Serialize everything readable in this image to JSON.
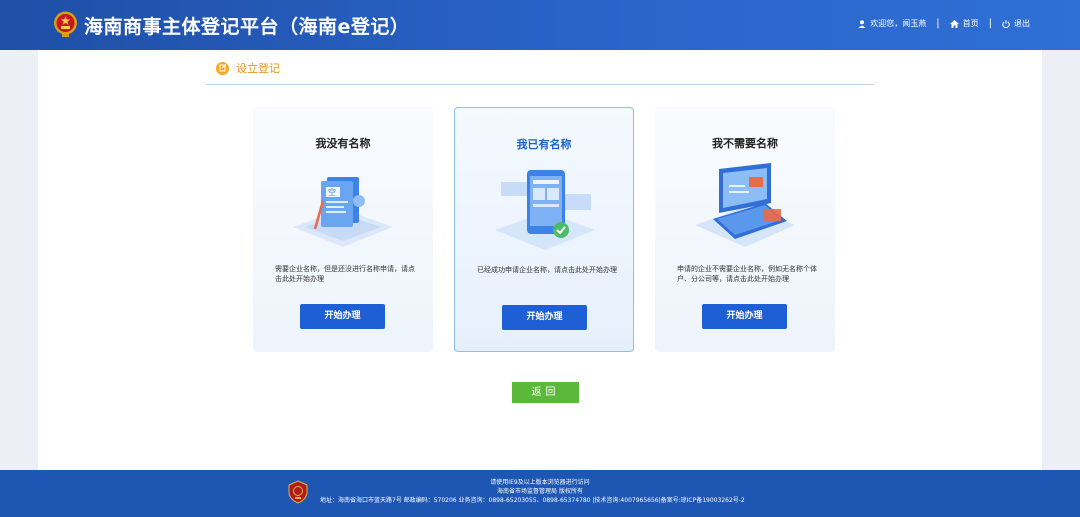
{
  "header": {
    "site_title": "海南商事主体登记平台（海南e登记）",
    "welcome": "欢迎您，闻玉燕",
    "home": "首页",
    "logout": "退出",
    "separator": "|"
  },
  "section": {
    "title": "设立登记"
  },
  "cards": [
    {
      "title": "我没有名称",
      "desc": "需要企业名称，但是还没进行名称申请，请点击此处开始办理",
      "button": "开始办理"
    },
    {
      "title": "我已有名称",
      "desc": "已经成功申请企业名称，请点击此处开始办理",
      "button": "开始办理"
    },
    {
      "title": "我不需要名称",
      "desc": "申请的企业不需要企业名称，例如无名称个体户、分公司等，请点击此处开始办理",
      "button": "开始办理"
    }
  ],
  "back_button": "返回",
  "footer": {
    "line1": "请使用IE9及以上版本浏览器进行访问",
    "line2": "海南省市场监督管理局 版权所有",
    "line3": "地址：海南省海口市蓝天路7号 邮政编码：570206 业务咨询：0898-65203055、0898-65374780 |技术咨询:4007965656|备案号:琼ICP备19003262号-2"
  },
  "colors": {
    "header_blue": "#2a64c9",
    "accent_orange": "#e8931b",
    "button_blue": "#1f5fd6",
    "back_green": "#5cb83a",
    "footer_blue": "#1d57b3"
  }
}
